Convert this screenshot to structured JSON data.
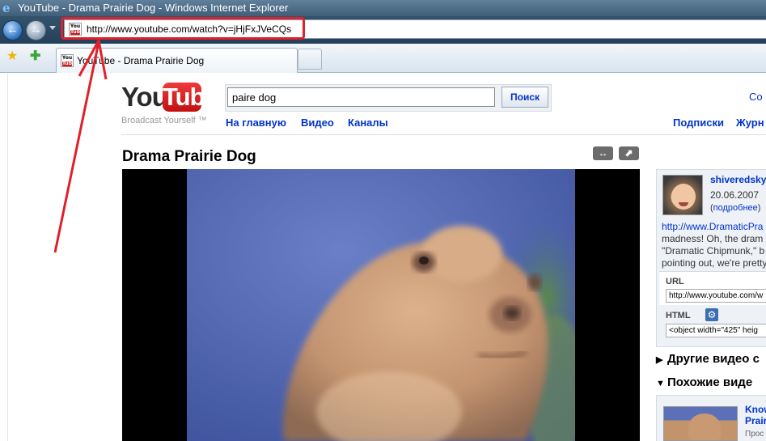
{
  "window": {
    "title": "YouTube - Drama Prairie Dog - Windows Internet Explorer"
  },
  "address": {
    "url": "http://www.youtube.com/watch?v=jHjFxJVeCQs"
  },
  "tab": {
    "label": "YouTube - Drama Prairie Dog"
  },
  "favicon": {
    "line1": "You",
    "line2": "Tube"
  },
  "logo": {
    "you": "You",
    "tube": "Tube",
    "tagline": "Broadcast Yourself ™"
  },
  "search": {
    "value": "paire dog",
    "button": "Поиск"
  },
  "header": {
    "top_right_link": "Co"
  },
  "nav": {
    "home": "На главную",
    "video": "Видео",
    "channels": "Каналы",
    "subscriptions": "Подписки",
    "journal": "Журн"
  },
  "video": {
    "title": "Drama Prairie Dog",
    "expand_label": "↔",
    "popout_label": "⬈"
  },
  "uploader": {
    "name": "shiveredsky",
    "date": "20.06.2007",
    "more_prefix": "(",
    "more_label": "подробнее",
    "more_suffix": ")"
  },
  "description": {
    "link": "http://www.DramaticPra",
    "line1": "madness! Oh, the dram",
    "line2": "\"Dramatic Chipmunk,\" b",
    "line3": "pointing out, we're pretty"
  },
  "share": {
    "url_label": "URL",
    "url_value": "http://www.youtube.com/w",
    "html_label": "HTML",
    "html_value": "<object width=\"425\" heig"
  },
  "sections": {
    "other_videos": "Другие видео с",
    "related_videos": "Похожие виде"
  },
  "related": {
    "title_line1": "Know",
    "title_line2": "Prair",
    "sub": "Прос"
  },
  "colors": {
    "annotation_red": "#e0202a",
    "link_blue": "#0033cc",
    "youtube_red": "#cc1a1a"
  }
}
